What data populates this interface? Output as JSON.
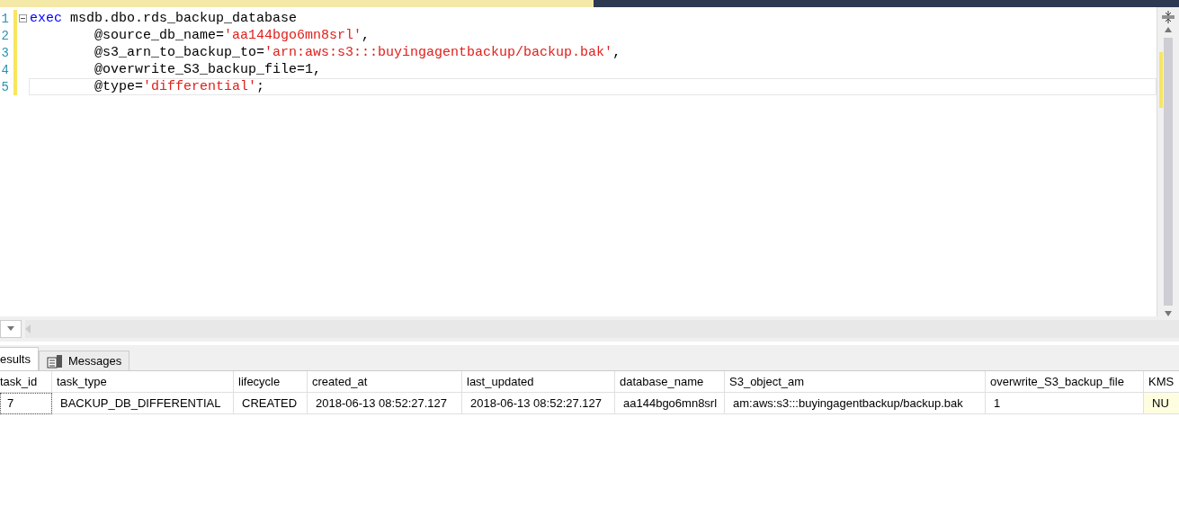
{
  "editor": {
    "lines": [
      {
        "number": "1",
        "current": false,
        "collapsible": true,
        "segments": [
          {
            "kind": "keyword",
            "text": "exec"
          },
          {
            "kind": "plain",
            "text": " msdb.dbo.rds_backup_database"
          }
        ]
      },
      {
        "number": "2",
        "current": false,
        "collapsible": false,
        "segments": [
          {
            "kind": "plain",
            "text": "        @source_db_name="
          },
          {
            "kind": "string",
            "text": "'aa144bgo6mn8srl'"
          },
          {
            "kind": "plain",
            "text": ","
          }
        ]
      },
      {
        "number": "3",
        "current": false,
        "collapsible": false,
        "segments": [
          {
            "kind": "plain",
            "text": "        @s3_arn_to_backup_to="
          },
          {
            "kind": "string",
            "text": "'arn:aws:s3:::buyingagentbackup/backup.bak'"
          },
          {
            "kind": "plain",
            "text": ","
          }
        ]
      },
      {
        "number": "4",
        "current": false,
        "collapsible": false,
        "segments": [
          {
            "kind": "plain",
            "text": "        @overwrite_S3_backup_file=1,"
          }
        ]
      },
      {
        "number": "5",
        "current": true,
        "collapsible": false,
        "segments": [
          {
            "kind": "plain",
            "text": "        @type="
          },
          {
            "kind": "string",
            "text": "'differential'"
          },
          {
            "kind": "plain",
            "text": ";"
          }
        ]
      }
    ]
  },
  "results_tabs": [
    {
      "label": "esults",
      "selected": true
    },
    {
      "label": "Messages",
      "selected": false
    }
  ],
  "table": {
    "columns": [
      "task_id",
      "task_type",
      "lifecycle",
      "created_at",
      "last_updated",
      "database_name",
      "S3_object_am",
      "overwrite_S3_backup_file",
      "KMS"
    ],
    "rows": [
      [
        {
          "text": "7",
          "is_null": false
        },
        {
          "text": "BACKUP_DB_DIFFERENTIAL",
          "is_null": false
        },
        {
          "text": "CREATED",
          "is_null": false
        },
        {
          "text": "2018-06-13 08:52:27.127",
          "is_null": false
        },
        {
          "text": "2018-06-13 08:52:27.127",
          "is_null": false
        },
        {
          "text": "aa144bgo6mn8srl",
          "is_null": false
        },
        {
          "text": "am:aws:s3:::buyingagentbackup/backup.bak",
          "is_null": false
        },
        {
          "text": "1",
          "is_null": false
        },
        {
          "text": "NU",
          "is_null": true
        }
      ]
    ]
  }
}
